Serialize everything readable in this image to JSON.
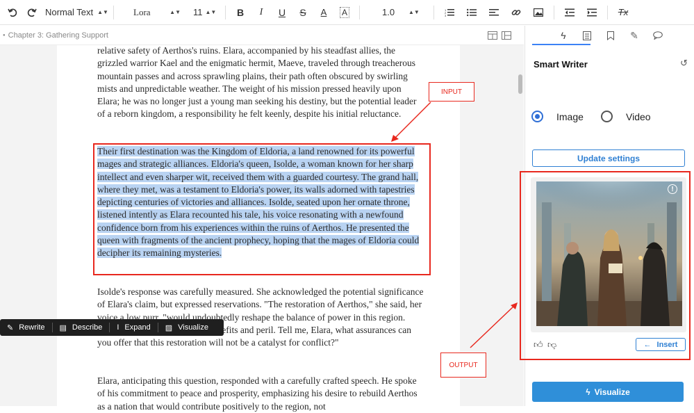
{
  "toolbar": {
    "undo_icon": "undo-icon",
    "redo_icon": "redo-icon",
    "style_select": "Normal Text",
    "font_select": "Lora",
    "size_select": "11",
    "bold": "B",
    "italic": "I",
    "underline": "U",
    "strike": "S",
    "text_color": "A",
    "highlight": "A",
    "line_spacing": "1.0",
    "clear_format": "Tx"
  },
  "breadcrumb": "Chapter 3: Gathering Support",
  "document": {
    "para1": "relative safety of Aerthos's ruins.  Elara, accompanied by his steadfast allies, the grizzled warrior Kael and the enigmatic hermit, Maeve, traveled through treacherous mountain passes and across sprawling plains, their path often obscured by swirling mists and unpredictable weather.  The weight of his mission pressed heavily upon Elara; he was no longer just a young man seeking his destiny, but the potential leader of a reborn kingdom, a responsibility he felt keenly, despite his initial reluctance.",
    "para2": "Their first destination was the Kingdom of Eldoria, a land renowned for its powerful mages and strategic alliances.  Eldoria's queen, Isolde, a woman known for her sharp intellect and even sharper wit, received them with a guarded courtesy.  The grand hall, where they met, was a testament to Eldoria's power, its walls adorned with tapestries depicting centuries of victories and alliances.  Isolde, seated upon her ornate throne, listened intently as Elara recounted his tale, his voice resonating with a newfound confidence born from his experiences within the ruins of Aerthos.  He presented the queen with fragments of the ancient prophecy, hoping that the mages of Eldoria could decipher its remaining mysteries.",
    "para3": "Isolde's response was carefully measured.  She acknowledged the potential significance of Elara's claim, but expressed reservations.  \"The restoration of Aerthos,\" she said, her voice a low purr, \"would undoubtedly reshape the balance of power in this region.  Such a shift could bring both benefits and peril.  Tell me, Elara, what assurances can you offer that this restoration will not be a catalyst for conflict?\"",
    "para4": "Elara, anticipating this question, responded with a carefully crafted speech. He spoke of his commitment to peace and prosperity, emphasizing his desire to rebuild Aerthos as a nation that would contribute positively to the region, not"
  },
  "annotations": {
    "input": "INPUT",
    "output": "OUTPUT"
  },
  "floating_toolbar": {
    "rewrite": "Rewrite",
    "describe": "Describe",
    "expand": "Expand",
    "visualize": "Visualize"
  },
  "panel": {
    "title": "Smart Writer",
    "radio_image": "Image",
    "radio_video": "Video",
    "selected": "Image",
    "update_settings": "Update settings",
    "insert": "Insert",
    "insert_arrow": "←",
    "visualize": "Visualize"
  },
  "colors": {
    "accent": "#2f80d3",
    "annotation": "#e8281e",
    "highlight": "#b9d3f2"
  }
}
